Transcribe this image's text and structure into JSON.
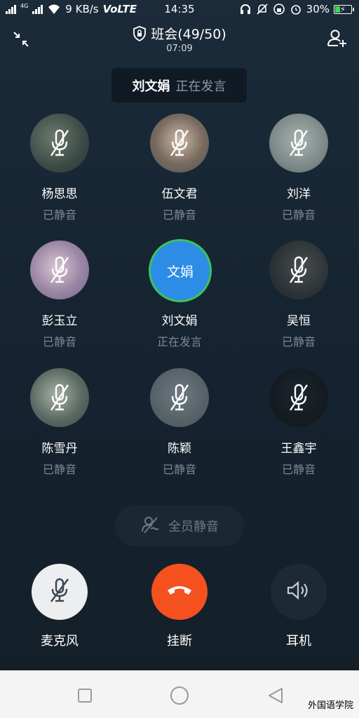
{
  "status_bar": {
    "net_label": "4G",
    "speed": "9 KB/s",
    "volte": "VoLTE",
    "time": "14:35",
    "battery_percent": "30%",
    "battery_level": 0.3,
    "battery_color": "#44d35a"
  },
  "header": {
    "title": "班会(49/50)",
    "timer": "07:09",
    "collapse_icon": "collapse-icon",
    "add_member_icon": "add-user-icon",
    "lock_icon": "shield-lock-icon"
  },
  "speaking_banner": {
    "name": "刘文娟",
    "state": "正在发言"
  },
  "participants": [
    {
      "name": "杨思思",
      "status": "已静音"
    },
    {
      "name": "伍文君",
      "status": "已静音"
    },
    {
      "name": "刘洋",
      "status": "已静音"
    },
    {
      "name": "彭玉立",
      "status": "已静音"
    },
    {
      "name": "刘文娟",
      "status": "正在发言",
      "avatar_text": "文娟"
    },
    {
      "name": "吴恒",
      "status": "已静音"
    },
    {
      "name": "陈雪丹",
      "status": "已静音"
    },
    {
      "name": "陈颖",
      "status": "已静音"
    },
    {
      "name": "王鑫宇",
      "status": "已静音"
    }
  ],
  "mute_all": {
    "label": "全员静音"
  },
  "controls": {
    "mic": {
      "label": "麦克风"
    },
    "hangup": {
      "label": "挂断",
      "color": "#f4511e"
    },
    "earpiece": {
      "label": "耳机"
    }
  },
  "colors": {
    "background": "#16222e",
    "speaking_ring": "#3cc35b",
    "speaking_fill": "#2d8ce6",
    "muted_text": "#7d8893"
  },
  "navbar": {
    "watermark": "外国语学院"
  }
}
